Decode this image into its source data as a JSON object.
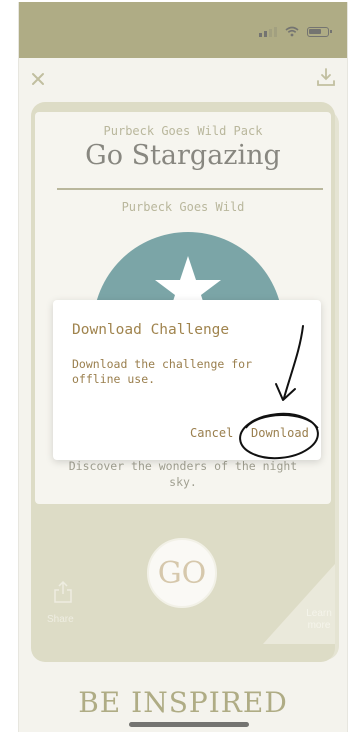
{
  "header": {
    "close_icon": "close-icon",
    "download_icon": "download-icon"
  },
  "card": {
    "pack_name": "Purbeck Goes Wild Pack",
    "title": "Go Stargazing",
    "subtitle": "Purbeck Goes Wild",
    "description_line1": "Discover the wonders of the night",
    "description_line2": "sky.",
    "go_label": "GO",
    "share_label": "Share",
    "learn_line1": "Learn",
    "learn_line2": "more"
  },
  "footer": {
    "be_inspired": "BE INSPIRED"
  },
  "dialog": {
    "title": "Download Challenge",
    "message_line1": "Download the challenge for",
    "message_line2": "offline use.",
    "cancel_label": "Cancel",
    "download_label": "Download"
  },
  "colors": {
    "brand_olive": "#7e7a3b",
    "teal": "#2b6f72",
    "dialog_text": "#9a7f4e"
  }
}
